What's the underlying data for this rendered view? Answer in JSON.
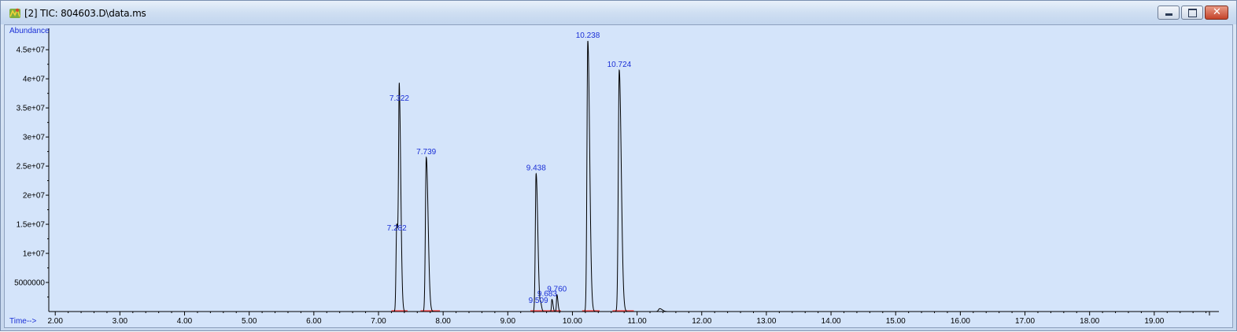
{
  "window": {
    "title": "[2] TIC: 804603.D\\data.ms",
    "controls": {
      "minimize": "minimize",
      "maximize": "maximize",
      "close": "close"
    }
  },
  "colors": {
    "trace": "#000000",
    "peak_label": "#1a2fd6",
    "axis_label": "#1a2fd6",
    "baseline": "#ff3b3b",
    "plot_bg": "#d4e4fa"
  },
  "chart_data": {
    "type": "line",
    "ylabel": "Abundance",
    "xlabel": "Time-->",
    "xlim": [
      1.9,
      20.0
    ],
    "ylim": [
      0,
      48000000
    ],
    "x_ticks": [
      "2.00",
      "3.00",
      "4.00",
      "5.00",
      "6.00",
      "7.00",
      "8.00",
      "9.00",
      "10.00",
      "11.00",
      "12.00",
      "13.00",
      "14.00",
      "15.00",
      "16.00",
      "17.00",
      "18.00",
      "19.00"
    ],
    "y_ticks": [
      {
        "value": 5000000,
        "label": "5000000"
      },
      {
        "value": 10000000,
        "label": "1e+07"
      },
      {
        "value": 15000000,
        "label": "1.5e+07"
      },
      {
        "value": 20000000,
        "label": "2e+07"
      },
      {
        "value": 25000000,
        "label": "2.5e+07"
      },
      {
        "value": 30000000,
        "label": "3e+07"
      },
      {
        "value": 35000000,
        "label": "3.5e+07"
      },
      {
        "value": 40000000,
        "label": "4e+07"
      },
      {
        "value": 45000000,
        "label": "4.5e+07"
      }
    ],
    "peaks": [
      {
        "rt": 7.282,
        "label": "7.282",
        "height": 15000000,
        "width": 0.018
      },
      {
        "rt": 7.322,
        "label": "7.322",
        "height": 35700000,
        "width": 0.018
      },
      {
        "rt": 7.739,
        "label": "7.739",
        "height": 26500000,
        "width": 0.022
      },
      {
        "rt": 9.438,
        "label": "9.438",
        "height": 23700000,
        "width": 0.02
      },
      {
        "rt": 9.509,
        "label": "9.509",
        "height": 1200000,
        "width": 0.012
      },
      {
        "rt": 9.683,
        "label": "9.683",
        "height": 2100000,
        "width": 0.012
      },
      {
        "rt": 9.76,
        "label": "9.760",
        "height": 2900000,
        "width": 0.012
      },
      {
        "rt": 10.238,
        "label": "10.238",
        "height": 46500000,
        "width": 0.022
      },
      {
        "rt": 10.724,
        "label": "10.724",
        "height": 41500000,
        "width": 0.024
      }
    ],
    "minor_peaks": [
      {
        "rt": 11.35,
        "height": 500000,
        "width": 0.03
      }
    ],
    "integration_baselines": [
      [
        7.2,
        7.45
      ],
      [
        7.65,
        7.95
      ],
      [
        9.35,
        9.62
      ],
      [
        9.62,
        9.82
      ],
      [
        10.15,
        10.42
      ],
      [
        10.62,
        10.95
      ]
    ]
  }
}
